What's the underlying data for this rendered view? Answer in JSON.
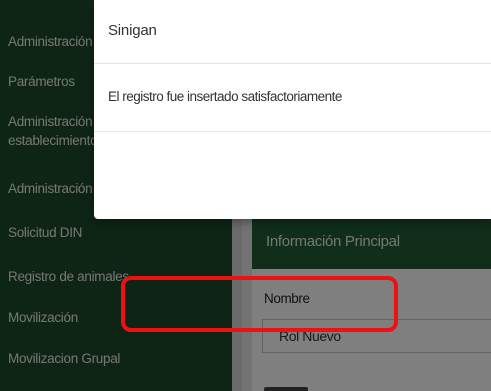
{
  "sidebar": {
    "items": [
      {
        "label": "Administración"
      },
      {
        "label": "Parámetros"
      },
      {
        "label": "Administración de"
      },
      {
        "label": "establecimientos"
      },
      {
        "label": "Administración"
      },
      {
        "label": "Solicitud DIN"
      },
      {
        "label": "Registro de animales"
      },
      {
        "label": "Movilización"
      },
      {
        "label": "Movilizacion Grupal"
      }
    ]
  },
  "main": {
    "panel_title": "Información Principal",
    "name_label": "Nombre",
    "name_value": "Rol Nuevo"
  },
  "modal": {
    "title": "Sinigan",
    "message": "El registro fue insertado satisfactoriamente"
  },
  "colors": {
    "sidebar_bg": "#1c4a2a",
    "panel_header_bg": "#215c35",
    "highlight": "#ee1111"
  }
}
